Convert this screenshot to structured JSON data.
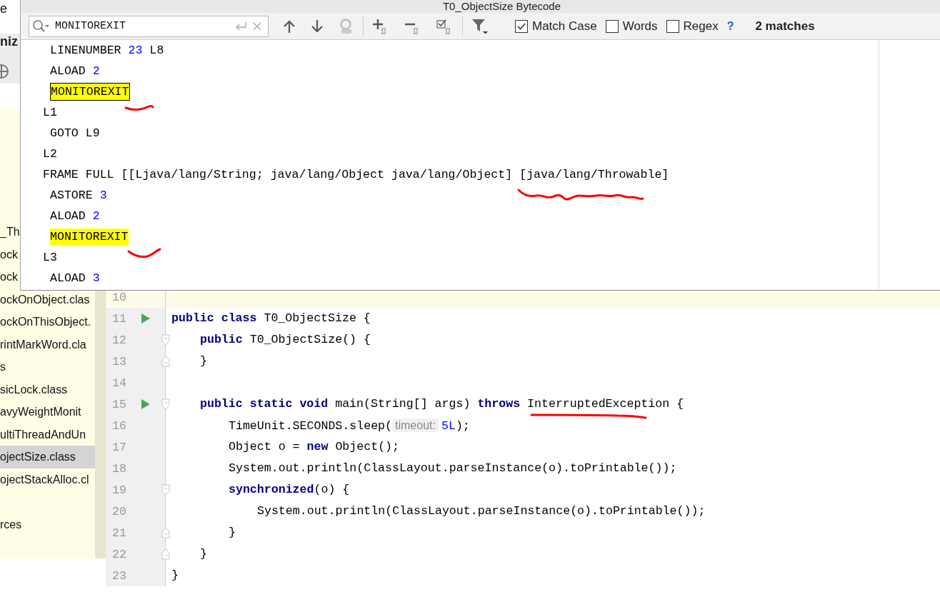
{
  "sidebar": {
    "header_text": "e",
    "toolbar_label": "niz",
    "items": [
      {
        "kind": "file",
        "label": "_Th",
        "selected": false
      },
      {
        "kind": "file",
        "label": "ock",
        "selected": false
      },
      {
        "kind": "file",
        "label": "ock",
        "selected": false
      },
      {
        "kind": "file",
        "label": "ockOnObject.clas",
        "selected": false
      },
      {
        "kind": "file",
        "label": "ockOnThisObject.",
        "selected": false
      },
      {
        "kind": "file",
        "label": "rintMarkWord.cla",
        "selected": false
      },
      {
        "kind": "file",
        "label": "s",
        "selected": false
      },
      {
        "kind": "file",
        "label": "sicLock.class",
        "selected": false
      },
      {
        "kind": "file",
        "label": "avyWeightMonit",
        "selected": false
      },
      {
        "kind": "file",
        "label": "ultiThreadAndUn",
        "selected": false
      },
      {
        "kind": "file",
        "label": "ojectSize.class",
        "selected": true
      },
      {
        "kind": "file",
        "label": "ojectStackAlloc.cl",
        "selected": false
      },
      {
        "kind": "blank"
      },
      {
        "kind": "file",
        "label": "rces",
        "selected": false
      }
    ]
  },
  "bytecode_window": {
    "title": "T0_ObjectSize Bytecode",
    "find": {
      "value": "MONITOREXIT",
      "options": [
        {
          "label": "Match Case",
          "checked": true
        },
        {
          "label": "Words",
          "checked": false
        },
        {
          "label": "Regex",
          "checked": false
        }
      ],
      "help": "?",
      "matches": "2 matches"
    },
    "lines": [
      {
        "kind": "instruction",
        "parts": [
          {
            "kind": "text",
            "text": "LINENUMBER "
          },
          {
            "kind": "number",
            "text": "23"
          },
          {
            "kind": "text",
            "text": " L8"
          }
        ]
      },
      {
        "kind": "instruction",
        "parts": [
          {
            "kind": "text",
            "text": "ALOAD "
          },
          {
            "kind": "number",
            "text": "2"
          }
        ]
      },
      {
        "kind": "instruction",
        "parts": [
          {
            "kind": "match",
            "text": "MONITOREXIT",
            "selected": true
          }
        ]
      },
      {
        "kind": "label",
        "parts": [
          {
            "kind": "text",
            "text": "L1"
          }
        ]
      },
      {
        "kind": "instruction",
        "parts": [
          {
            "kind": "text",
            "text": "GOTO L9"
          }
        ]
      },
      {
        "kind": "label",
        "parts": [
          {
            "kind": "text",
            "text": "L2"
          }
        ]
      },
      {
        "kind": "label",
        "parts": [
          {
            "kind": "text",
            "text": "FRAME FULL [[Ljava/lang/String; java/lang/Object java/lang/Object] [java/lang/Throwable]"
          }
        ]
      },
      {
        "kind": "instruction",
        "parts": [
          {
            "kind": "text",
            "text": "ASTORE "
          },
          {
            "kind": "number",
            "text": "3"
          }
        ]
      },
      {
        "kind": "instruction",
        "parts": [
          {
            "kind": "text",
            "text": "ALOAD "
          },
          {
            "kind": "number",
            "text": "2"
          }
        ]
      },
      {
        "kind": "instruction",
        "parts": [
          {
            "kind": "match",
            "text": "MONITOREXIT",
            "selected": false
          }
        ]
      },
      {
        "kind": "label",
        "parts": [
          {
            "kind": "text",
            "text": "L3"
          }
        ]
      },
      {
        "kind": "instruction",
        "parts": [
          {
            "kind": "text",
            "text": "ALOAD "
          },
          {
            "kind": "number",
            "text": "3"
          }
        ]
      }
    ]
  },
  "editor": {
    "lines": [
      {
        "number": "10",
        "current": true,
        "run": false
      },
      {
        "number": "11",
        "current": false,
        "run": true,
        "parts": [
          {
            "kind": "keyword",
            "text": "public class"
          },
          {
            "kind": "text",
            "text": " T0_ObjectSize {"
          }
        ],
        "children": [
          {
            "number": "12",
            "current": false,
            "run": false,
            "fold": {
              "kind": "start"
            },
            "parts": [
              {
                "kind": "keyword",
                "text": "public"
              },
              {
                "kind": "text",
                "text": " T0_ObjectSize() {"
              }
            ]
          },
          {
            "number": "13",
            "current": false,
            "run": false,
            "fold": {
              "kind": "end"
            },
            "parts": [
              {
                "kind": "text",
                "text": "}"
              }
            ]
          },
          {
            "number": "14",
            "current": false,
            "run": false
          },
          {
            "number": "15",
            "current": false,
            "run": true,
            "fold": {
              "kind": "start"
            },
            "parts": [
              {
                "kind": "keyword",
                "text": "public static void"
              },
              {
                "kind": "text",
                "text": " main(String[] args) "
              },
              {
                "kind": "keyword",
                "text": "throws"
              },
              {
                "kind": "text",
                "text": " InterruptedException {"
              }
            ],
            "children": [
              {
                "number": "16",
                "current": false,
                "run": false,
                "parts": [
                  {
                    "kind": "text",
                    "text": "TimeUnit.SECONDS.sleep("
                  },
                  {
                    "kind": "hint",
                    "text": "timeout:"
                  },
                  {
                    "kind": "number",
                    "text": "5L"
                  },
                  {
                    "kind": "text",
                    "text": ");"
                  }
                ]
              },
              {
                "number": "17",
                "current": false,
                "run": false,
                "parts": [
                  {
                    "kind": "text",
                    "text": "Object o = "
                  },
                  {
                    "kind": "keyword",
                    "text": "new"
                  },
                  {
                    "kind": "text",
                    "text": " Object();"
                  }
                ]
              },
              {
                "number": "18",
                "current": false,
                "run": false,
                "parts": [
                  {
                    "kind": "text",
                    "text": "System.out.println(ClassLayout.parseInstance(o).toPrintable());"
                  }
                ]
              },
              {
                "number": "19",
                "current": false,
                "run": false,
                "fold": {
                  "kind": "start"
                },
                "parts": [
                  {
                    "kind": "keyword",
                    "text": "synchronized"
                  },
                  {
                    "kind": "text",
                    "text": "(o) {"
                  }
                ],
                "children": [
                  {
                    "number": "20",
                    "current": false,
                    "run": false,
                    "parts": [
                      {
                        "kind": "text",
                        "text": "System.out.println(ClassLayout.parseInstance(o).toPrintable());"
                      }
                    ]
                  }
                ]
              },
              {
                "number": "21",
                "current": false,
                "run": false,
                "fold": {
                  "kind": "end"
                },
                "parts": [
                  {
                    "kind": "text",
                    "text": "}"
                  }
                ]
              }
            ]
          },
          {
            "number": "22",
            "current": false,
            "run": false,
            "fold": {
              "kind": "end"
            },
            "parts": [
              {
                "kind": "text",
                "text": "}"
              }
            ]
          }
        ]
      },
      {
        "number": "23",
        "current": false,
        "run": false,
        "parts": [
          {
            "kind": "text",
            "text": "}"
          }
        ]
      }
    ]
  }
}
